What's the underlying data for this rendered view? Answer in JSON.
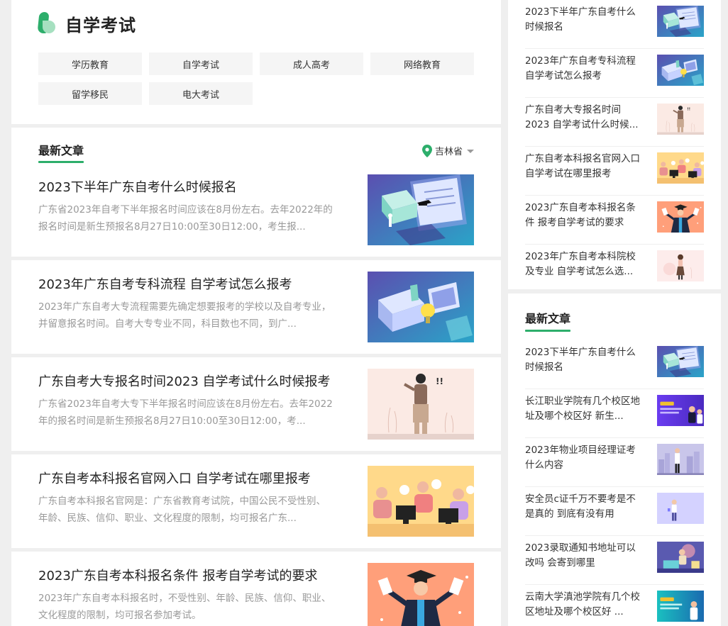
{
  "category": {
    "title": "自学考试",
    "tags": [
      "学历教育",
      "自学考试",
      "成人高考",
      "网络教育",
      "留学移民",
      "电大考试"
    ]
  },
  "latest": {
    "heading": "最新文章",
    "province": "吉林省",
    "articles": [
      {
        "title": "2023下半年广东自考什么时候报名",
        "desc": "广东省2023年自考下半年报名时间应该在8月份左右。去年2022年的报名时间是新生预报名8月27日10:00至30日12:00，考生报..."
      },
      {
        "title": "2023年广东自考专科流程 自学考试怎么报考",
        "desc": "2023年广东自考大专流程需要先确定想要报考的学校以及自考专业，并留意报名时间。自考大专专业不同，科目数也不同，到广..."
      },
      {
        "title": "广东自考大专报名时间2023 自学考试什么时候报考",
        "desc": "广东省2023年自考大专下半年报名时间应该在8月份左右。去年2022年的报名时间是新生预报名8月27日10:00至30日12:00，考..."
      },
      {
        "title": "广东自考本科报名官网入口 自学考试在哪里报考",
        "desc": "广东自考本科报名官网是：广东省教育考试院，中国公民不受性别、年龄、民族、信仰、职业、文化程度的限制，均可报名广东..."
      },
      {
        "title": "2023广东自考本科报名条件 报考自学考试的要求",
        "desc": "2023年广东自考本科报名时，不受性别、年龄、民族、信仰、职业、文化程度的限制，均可报名参加考试。"
      }
    ]
  },
  "sidebar": {
    "top_list": [
      {
        "title": "2023下半年广东自考什么时候报名",
        "img": "exam"
      },
      {
        "title": "2023年广东自考专科流程 自学考试怎么报考",
        "img": "exam2"
      },
      {
        "title": "广东自考大专报名时间2023 自学考试什么时候...",
        "img": "person"
      },
      {
        "title": "广东自考本科报名官网入口 自学考试在哪里报考",
        "img": "computers"
      },
      {
        "title": "2023广东自考本科报名条件 报考自学考试的要求",
        "img": "grad"
      },
      {
        "title": "2023年广东自考本科院校及专业 自学考试怎么选...",
        "img": "girl"
      }
    ],
    "latest_heading": "最新文章",
    "latest_list": [
      {
        "title": "2023下半年广东自考什么时候报名",
        "img": "exam"
      },
      {
        "title": "长江职业学院有几个校区地址及哪个校区好 新生...",
        "img": "purple"
      },
      {
        "title": "2023年物业项目经理证考什么内容",
        "img": "city"
      },
      {
        "title": "安全员c证千万不要考是不是真的 到底有没有用",
        "img": "lav"
      },
      {
        "title": "2023录取通知书地址可以改吗 会寄到哪里",
        "img": "desk"
      },
      {
        "title": "云南大学滇池学院有几个校区地址及哪个校区好 ...",
        "img": "teal"
      }
    ]
  },
  "colors": {
    "accent": "#2dae6b",
    "bg": "#efefef"
  }
}
